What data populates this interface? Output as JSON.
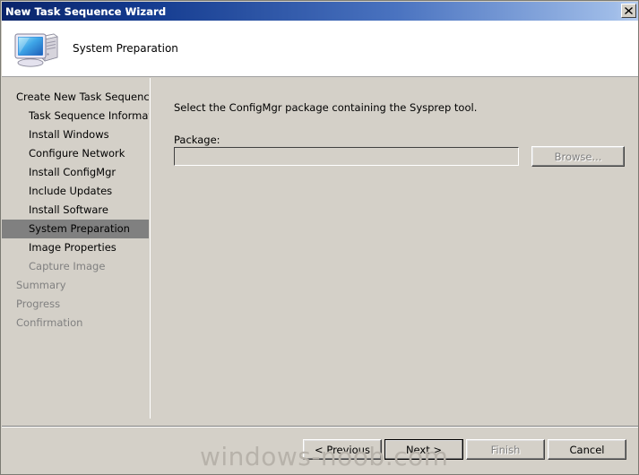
{
  "window": {
    "title": "New Task Sequence Wizard",
    "close_icon": "close-icon"
  },
  "header": {
    "icon": "computer-icon",
    "title": "System Preparation"
  },
  "sidebar": {
    "items": [
      {
        "label": "Create New Task Sequence",
        "level": 0,
        "state": "normal"
      },
      {
        "label": "Task Sequence Information",
        "level": 1,
        "state": "normal"
      },
      {
        "label": "Install Windows",
        "level": 1,
        "state": "normal"
      },
      {
        "label": "Configure Network",
        "level": 1,
        "state": "normal"
      },
      {
        "label": "Install ConfigMgr",
        "level": 1,
        "state": "normal"
      },
      {
        "label": "Include Updates",
        "level": 1,
        "state": "normal"
      },
      {
        "label": "Install Software",
        "level": 1,
        "state": "normal"
      },
      {
        "label": "System Preparation",
        "level": 1,
        "state": "selected"
      },
      {
        "label": "Image Properties",
        "level": 1,
        "state": "normal"
      },
      {
        "label": "Capture Image",
        "level": 1,
        "state": "disabled"
      },
      {
        "label": "Summary",
        "level": 0,
        "state": "disabled"
      },
      {
        "label": "Progress",
        "level": 0,
        "state": "disabled"
      },
      {
        "label": "Confirmation",
        "level": 0,
        "state": "disabled"
      }
    ],
    "scrollbar": {
      "left_arrow_icon": "arrow-left-icon",
      "right_arrow_icon": "arrow-right-icon"
    }
  },
  "main": {
    "instruction": "Select the ConfigMgr package containing the Sysprep tool.",
    "package_label": "Package:",
    "package_value": "",
    "package_placeholder": "",
    "browse_label": "Browse...",
    "browse_enabled": false
  },
  "footer": {
    "previous_label": "< Previous",
    "next_label": "Next >",
    "finish_label": "Finish",
    "cancel_label": "Cancel",
    "finish_enabled": false,
    "default_button": "Next >"
  },
  "watermark": {
    "text": "windows-noob.com"
  },
  "colors": {
    "face": "#d4d0c8",
    "title_start": "#0a246a",
    "title_end": "#b6cdf0",
    "selection": "#808080",
    "disabled_text": "#808080",
    "header_band": "#ffffff"
  }
}
